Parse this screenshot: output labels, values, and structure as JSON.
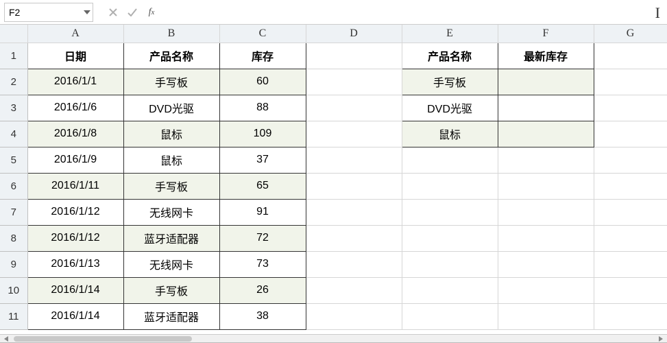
{
  "namebox": {
    "value": "F2"
  },
  "fx_label": "fx",
  "formula": {
    "value": ""
  },
  "columns": [
    "A",
    "B",
    "C",
    "D",
    "E",
    "F",
    "G"
  ],
  "row_numbers": [
    1,
    2,
    3,
    4,
    5,
    6,
    7,
    8,
    9,
    10,
    11
  ],
  "table1": {
    "headers": [
      "日期",
      "产品名称",
      "库存"
    ],
    "rows": [
      {
        "date": "2016/1/1",
        "product": "手写板",
        "stock": "60"
      },
      {
        "date": "2016/1/6",
        "product": "DVD光驱",
        "stock": "88"
      },
      {
        "date": "2016/1/8",
        "product": "鼠标",
        "stock": "109"
      },
      {
        "date": "2016/1/9",
        "product": "鼠标",
        "stock": "37"
      },
      {
        "date": "2016/1/11",
        "product": "手写板",
        "stock": "65"
      },
      {
        "date": "2016/1/12",
        "product": "无线网卡",
        "stock": "91"
      },
      {
        "date": "2016/1/12",
        "product": "蓝牙适配器",
        "stock": "72"
      },
      {
        "date": "2016/1/13",
        "product": "无线网卡",
        "stock": "73"
      },
      {
        "date": "2016/1/14",
        "product": "手写板",
        "stock": "26"
      },
      {
        "date": "2016/1/14",
        "product": "蓝牙适配器",
        "stock": "38"
      }
    ]
  },
  "table2": {
    "headers": [
      "产品名称",
      "最新库存"
    ],
    "rows": [
      {
        "product": "手写板",
        "latest": ""
      },
      {
        "product": "DVD光驱",
        "latest": ""
      },
      {
        "product": "鼠标",
        "latest": ""
      }
    ]
  }
}
